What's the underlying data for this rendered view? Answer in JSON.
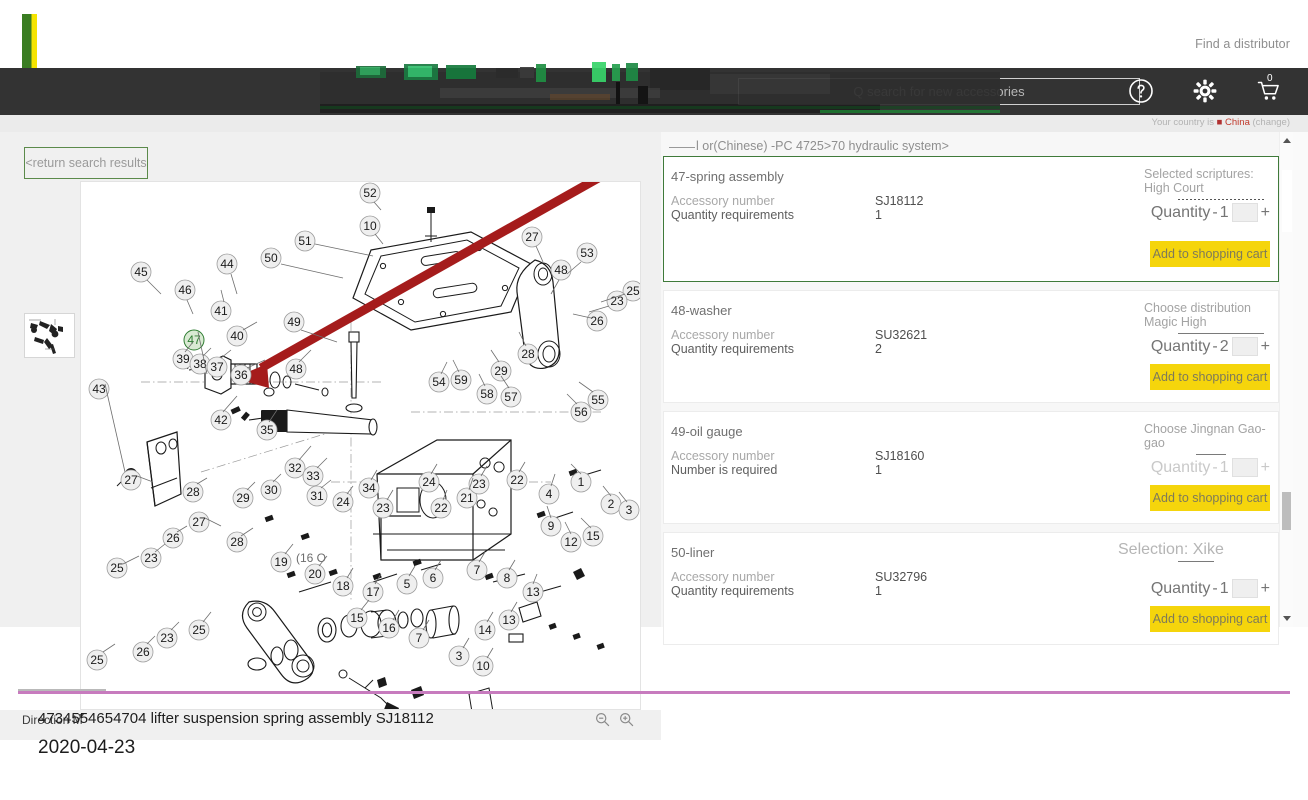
{
  "utility_bar": {
    "find_distributor": "Find a distributor"
  },
  "header": {
    "search": {
      "placeholder": "Q search for new accessories",
      "value": ""
    },
    "icons": {
      "help": "help-icon",
      "settings": "gear-icon",
      "cart": "cart-icon"
    },
    "cart_count": "0"
  },
  "country_bar": {
    "prefix": "Your country is",
    "country": "China",
    "change": "(change)"
  },
  "left_pane": {
    "return_button": "<return search results",
    "direction_label": "Direction M",
    "zoom_out": "zoom-out-icon",
    "zoom_in": "zoom-in-icon"
  },
  "right_pane": {
    "breadcrumb": "l or(Chinese) -PC 4725>70 hydraulic system>",
    "cards": [
      {
        "title": "47-spring assembly",
        "accessory_label": "Accessory number",
        "accessory_value": "SJ18112",
        "quantity_label": "Quantity requirements",
        "quantity_value": "1",
        "chooser": "Selected scriptures: High Court",
        "qty_prefix": "Quantity",
        "qty_minus": "-",
        "qty_value": "1",
        "qty_plus": "+",
        "cart_label": "Add to shopping cart",
        "selected": true
      },
      {
        "title": "48-washer",
        "accessory_label": "Accessory number",
        "accessory_value": "SU32621",
        "quantity_label": "Quantity requirements",
        "quantity_value": "2",
        "chooser": "Choose distribution Magic High",
        "qty_prefix": "Quantity",
        "qty_minus": "-",
        "qty_value": "2",
        "qty_plus": "+",
        "cart_label": "Add to shopping cart",
        "selected": false
      },
      {
        "title": "49-oil gauge",
        "accessory_label": "Accessory number",
        "accessory_value": "SJ18160",
        "quantity_label": "Number is required",
        "quantity_value": "1",
        "chooser": "Choose Jingnan Gao-gao",
        "qty_prefix": "Quantity",
        "qty_minus": "-",
        "qty_value": "1",
        "qty_plus": "+",
        "cart_label": "Add to shopping cart",
        "selected": false
      },
      {
        "title": "50-liner",
        "accessory_label": "Accessory number",
        "accessory_value": "SU32796",
        "quantity_label": "Quantity requirements",
        "quantity_value": "1",
        "chooser": "Selection: Xike",
        "qty_prefix": "Quantity",
        "qty_minus": "-",
        "qty_value": "1",
        "qty_plus": "+",
        "cart_label": "Add to shopping cart",
        "selected": false
      }
    ]
  },
  "footer": {
    "caption": "4734554654704 lifter suspension spring assembly SJ18112",
    "date": "2020-04-23"
  },
  "colors": {
    "accent_yellow": "#f5d50c",
    "brand_green": "#3a7d22",
    "brand_yellow": "#f5e400",
    "header_dark": "#333333",
    "selected_border": "#3f7a3a",
    "footer_rule": "#c77bbe",
    "arrow_red": "#a51c1c",
    "highlight_balloon": "#2f7d32"
  },
  "diagram": {
    "highlighted_part": "47",
    "callouts": [
      "52",
      "10",
      "51",
      "50",
      "27",
      "53",
      "48",
      "25",
      "23",
      "26",
      "28",
      "29",
      "54",
      "58",
      "57",
      "55",
      "56",
      "59",
      "45",
      "46",
      "47",
      "44",
      "41",
      "49",
      "40",
      "39",
      "38",
      "37",
      "36",
      "35",
      "43",
      "42",
      "32",
      "33",
      "34",
      "31",
      "30",
      "24",
      "22",
      "21",
      "20",
      "19",
      "18",
      "17",
      "15",
      "16",
      "9",
      "12",
      "1",
      "2",
      "3",
      "4",
      "5",
      "6",
      "7",
      "8",
      "13",
      "14"
    ],
    "note": "(16 O..."
  }
}
